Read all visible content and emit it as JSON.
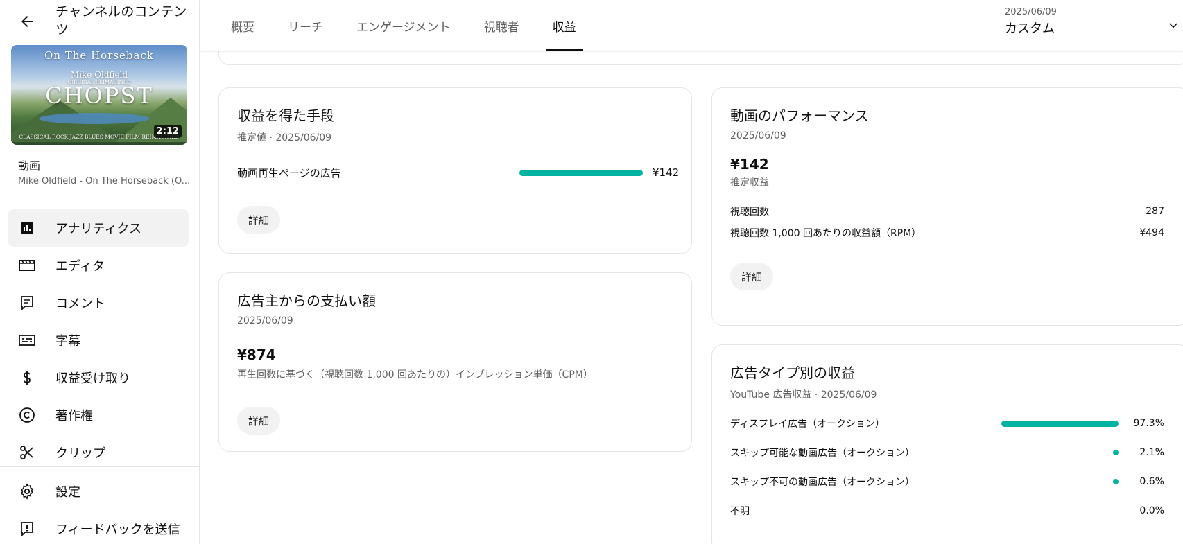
{
  "sidebar": {
    "title": "チャンネルのコンテンツ",
    "thumbnail": {
      "line1": "On The Horseback",
      "line2": "Mike Oldfield",
      "line3": "ORIGINAL REIMAGINED",
      "line4": "CHOPST",
      "line5": "CLASSICAL ROCK JAZZ BLUES MOVIE FILM REIMAGINED",
      "duration": "2:12"
    },
    "video_label": "動画",
    "video_name": "Mike Oldfield - On The Horseback (O...",
    "items": [
      {
        "label": "アナリティクス",
        "icon": "analytics-icon"
      },
      {
        "label": "エディタ",
        "icon": "editor-icon"
      },
      {
        "label": "コメント",
        "icon": "comment-icon"
      },
      {
        "label": "字幕",
        "icon": "subtitles-icon"
      },
      {
        "label": "収益受け取り",
        "icon": "dollar-icon"
      },
      {
        "label": "著作権",
        "icon": "copyright-icon"
      },
      {
        "label": "クリップ",
        "icon": "scissors-icon"
      }
    ],
    "bottom_items": [
      {
        "label": "設定",
        "icon": "gear-icon"
      },
      {
        "label": "フィードバックを送信",
        "icon": "feedback-icon"
      }
    ]
  },
  "header": {
    "tabs": [
      "概要",
      "リーチ",
      "エンゲージメント",
      "視聴者",
      "収益"
    ],
    "active_tab": "収益",
    "date_range": {
      "date": "2025/06/09",
      "label": "カスタム"
    }
  },
  "cards": {
    "revenue_sources": {
      "title": "収益を得た手段",
      "subtitle": "推定値 · 2025/06/09",
      "rows": [
        {
          "label": "動画再生ページの広告",
          "value": "¥142",
          "share": 1.0
        }
      ],
      "detail_label": "詳細"
    },
    "advertiser_payments": {
      "title": "広告主からの支払い額",
      "subtitle": "2025/06/09",
      "value": "¥874",
      "description": "再生回数に基づく（視聴回数 1,000 回あたりの）インプレッション単価（CPM）",
      "detail_label": "詳細"
    },
    "video_performance": {
      "title": "動画のパフォーマンス",
      "subtitle": "2025/06/09",
      "value": "¥142",
      "value_label": "推定収益",
      "rows": [
        {
          "label": "視聴回数",
          "value": "287"
        },
        {
          "label": "視聴回数 1,000 回あたりの収益額（RPM）",
          "value": "¥494"
        }
      ],
      "detail_label": "詳細"
    },
    "ad_type_revenue": {
      "title": "広告タイプ別の収益",
      "subtitle": "YouTube 広告収益 · 2025/06/09",
      "rows": [
        {
          "label": "ディスプレイ広告（オークション）",
          "value": "97.3%",
          "share": 0.973
        },
        {
          "label": "スキップ可能な動画広告（オークション）",
          "value": "2.1%",
          "share": 0.021
        },
        {
          "label": "スキップ不可の動画広告（オークション）",
          "value": "0.6%",
          "share": 0.006
        },
        {
          "label": "不明",
          "value": "0.0%",
          "share": 0.0
        }
      ]
    }
  },
  "colors": {
    "accent": "#00b3a1",
    "text": "#0f0f0f",
    "muted": "#606060",
    "border": "#e5e5e5"
  }
}
